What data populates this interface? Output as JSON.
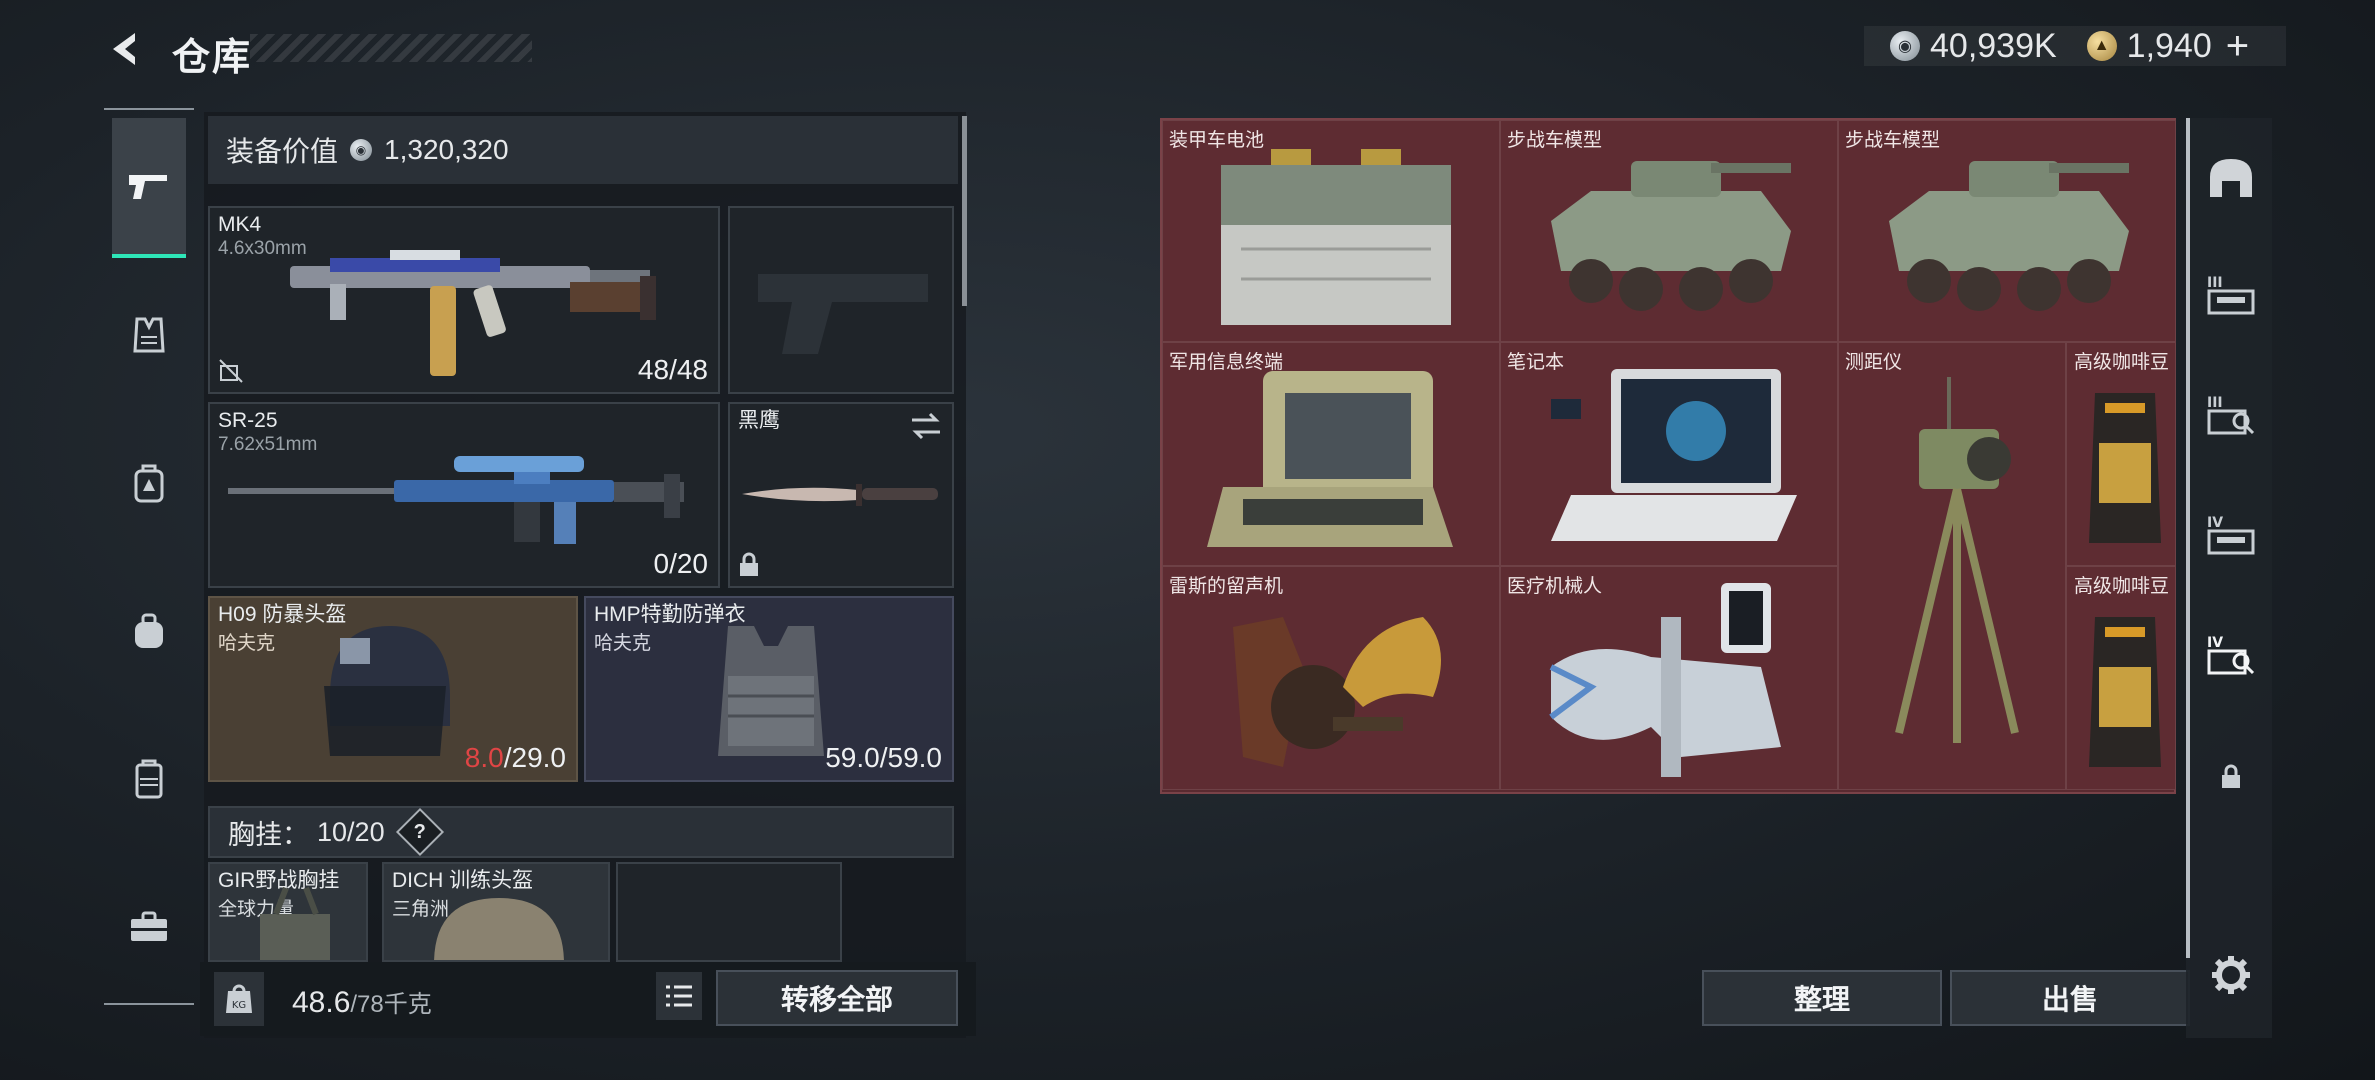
{
  "header": {
    "title": "仓库",
    "currency": [
      {
        "icon": "silver-coin-icon",
        "value": "40,939K"
      },
      {
        "icon": "gold-coin-icon",
        "value": "1,940"
      }
    ],
    "plus_label": "+"
  },
  "left_rail": {
    "items": [
      "pistol-icon",
      "armor-vest-icon",
      "backpack-icon",
      "rig-bag-icon",
      "case-icon",
      "toolbox-icon"
    ]
  },
  "loadout": {
    "value_label": "装备价值",
    "value": "1,320,320",
    "primary": {
      "name": "MK4",
      "caliber": "4.6x30mm",
      "ammo": "48/48"
    },
    "secondary_pistol": {
      "name": ""
    },
    "rifle": {
      "name": "SR-25",
      "caliber": "7.62x51mm",
      "ammo": "0/20"
    },
    "melee": {
      "name": "黑鹰"
    },
    "helmet": {
      "name": "H09 防暴头盔",
      "maker": "哈夫克",
      "durability_current": "8.0",
      "durability_max": "/29.0"
    },
    "armor": {
      "name": "HMP特勤防弹衣",
      "maker": "哈夫克",
      "durability": "59.0/59.0"
    },
    "rig_section": {
      "label": "胸挂：",
      "used": "10",
      "total": "/20",
      "help": "?"
    },
    "rig_items": [
      {
        "name": "GIR野战胸挂",
        "maker": "全球力量"
      },
      {
        "name": "DICH 训练头盔",
        "maker": "三角洲"
      }
    ],
    "weight": {
      "current": "48.6",
      "max": "/78千克"
    },
    "transfer_all": "转移全部"
  },
  "stash": {
    "items": [
      {
        "label": "装甲车电池",
        "icon": "battery-icon"
      },
      {
        "label": "步战车模型",
        "icon": "ifv-model-icon"
      },
      {
        "label": "步战车模型",
        "icon": "ifv-model-icon"
      },
      {
        "label": "军用信息终端",
        "icon": "terminal-icon"
      },
      {
        "label": "笔记本",
        "icon": "laptop-icon"
      },
      {
        "label": "测距仪",
        "icon": "rangefinder-icon"
      },
      {
        "label": "高级咖啡豆",
        "icon": "coffee-bag-icon"
      },
      {
        "label": "雷斯的留声机",
        "icon": "gramophone-icon"
      },
      {
        "label": "医疗机械人",
        "icon": "medical-robot-icon"
      },
      {
        "label": "高级咖啡豆",
        "icon": "coffee-bag-icon"
      }
    ],
    "sort_label": "整理",
    "sell_label": "出售"
  },
  "right_rail": {
    "items": [
      "dome-icon",
      "tier-3-storage-icon",
      "tier-3-search-icon",
      "tier-4-storage-icon",
      "tier-4-search-icon",
      "lock-icon",
      "settings-gear-icon"
    ]
  },
  "colors": {
    "accent": "#2ee6b8",
    "stash_bg": "#5a2a30",
    "warning": "#e04545"
  }
}
